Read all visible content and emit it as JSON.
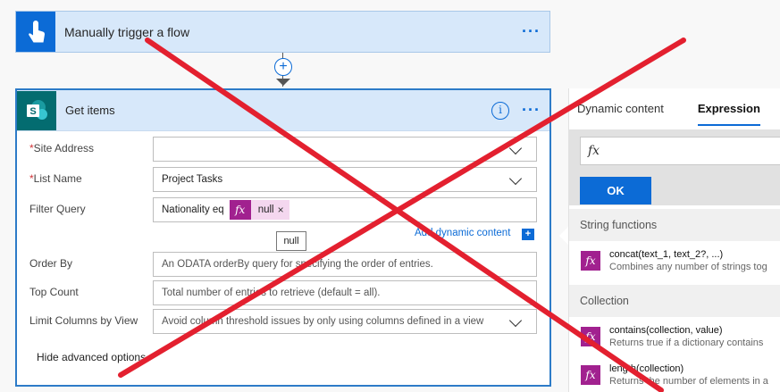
{
  "trigger": {
    "title": "Manually trigger a flow",
    "menu": "···"
  },
  "connector": {
    "plus": "+"
  },
  "action": {
    "title": "Get items",
    "menu": "···",
    "info": "i",
    "fields": {
      "site_address": {
        "label": "Site Address",
        "value": ""
      },
      "list_name": {
        "label": "List Name",
        "value": "Project Tasks"
      },
      "filter_query": {
        "label": "Filter Query",
        "prefix": "Nationality eq",
        "token_icon": "fx",
        "token_label": "null",
        "token_remove": "×"
      },
      "order_by": {
        "label": "Order By",
        "placeholder": "An ODATA orderBy query for specifying the order of entries."
      },
      "top_count": {
        "label": "Top Count",
        "placeholder": "Total number of entries to retrieve (default = all)."
      },
      "limit_columns": {
        "label": "Limit Columns by View",
        "placeholder": "Avoid column threshold issues by only using columns defined in a view"
      }
    },
    "required_mark": "*",
    "tooltip": "null",
    "add_dynamic_content": "Add dynamic content",
    "add_dynamic_plus": "+",
    "hide_advanced": "Hide advanced options"
  },
  "panel": {
    "tabs": [
      "Dynamic content",
      "Expression"
    ],
    "active_tab": "Expression",
    "expression_icon": "fx",
    "ok_label": "OK",
    "sections": [
      {
        "title": "String functions",
        "functions": [
          {
            "name": "concat(text_1, text_2?, ...)",
            "desc": "Combines any number of strings tog"
          }
        ]
      },
      {
        "title": "Collection",
        "functions": [
          {
            "name": "contains(collection, value)",
            "desc": "Returns true if a dictionary contains"
          },
          {
            "name": "length(collection)",
            "desc": "Returns the number of elements in a"
          }
        ]
      }
    ],
    "fx_icon": "fx"
  },
  "colors": {
    "accent": "#0c6bd6",
    "expression": "#a1218f",
    "sharepoint": "#036c70",
    "cross": "#e3202f"
  }
}
